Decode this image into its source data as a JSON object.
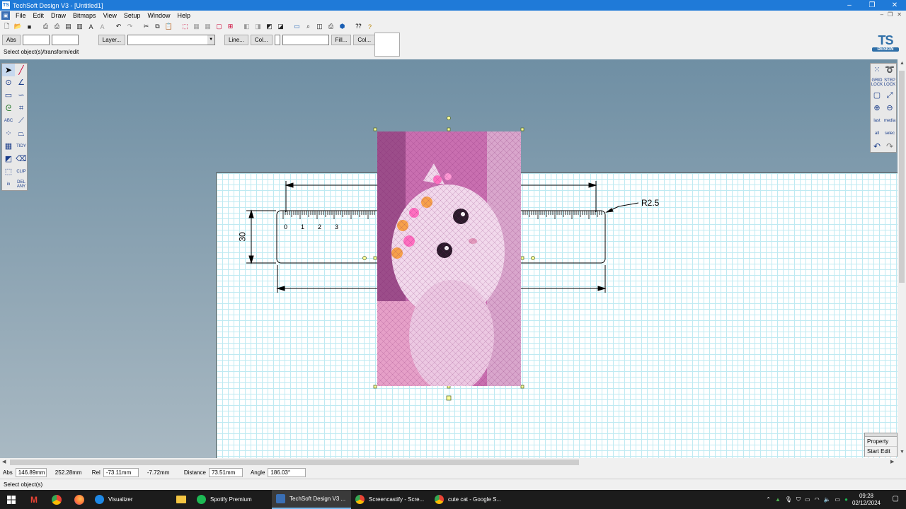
{
  "window": {
    "title": "TechSoft Design V3 - [Untitled1]",
    "app_icon": "TS",
    "controls": [
      "–",
      "❐",
      "✕"
    ]
  },
  "menu": [
    "File",
    "Edit",
    "Draw",
    "Bitmaps",
    "View",
    "Setup",
    "Window",
    "Help"
  ],
  "propbar": {
    "abs_label": "Abs",
    "layer_label": "Layer...",
    "line_label": "Line...",
    "col_label": "Col...",
    "fill_label": "Fill...",
    "col2_label": "Col..."
  },
  "status_hint": "Select object(s)/transform/edit",
  "logo": {
    "ts": "TS",
    "design": "DESIGN"
  },
  "left_tools": [
    "select-arrow",
    "line",
    "circle",
    "arc",
    "rectangle",
    "curve",
    "spiral",
    "grid-distort",
    "ABC",
    "text-warp",
    "dots",
    "perspective",
    "array",
    "TIDY",
    "layers",
    "eraser",
    "node",
    "CLIP",
    "in",
    "DEL ANY"
  ],
  "right_tools": [
    "grid-dots",
    "lasso",
    "GRID LOCK",
    "STEP LOCK",
    "box",
    "measure",
    "zoom-in",
    "zoom-out",
    "last",
    "media",
    "all",
    "selec",
    "undo",
    "redo"
  ],
  "drawing": {
    "radius_label": "R2.5",
    "height_label": "30",
    "ruler_numbers": [
      "0",
      "1",
      "2",
      "3"
    ]
  },
  "property_panel": {
    "property": "Property",
    "start_edit": "Start Edit"
  },
  "coords": {
    "abs_label": "Abs",
    "abs_x": "146.89mm",
    "abs_y": "252.28mm",
    "rel_label": "Rel",
    "rel_x": "-73.11mm",
    "rel_y": "-7.72mm",
    "distance_label": "Distance",
    "distance": "73.51mm",
    "angle_label": "Angle",
    "angle": "186.03°"
  },
  "message": "Select object(s)",
  "taskbar": {
    "apps": [
      {
        "label": "Visualizer",
        "color": "#1e88e5",
        "active": false
      },
      {
        "label": "Spotify Premium",
        "color": "#1db954",
        "active": false
      },
      {
        "label": "TechSoft Design V3 ...",
        "color": "#3a6fb5",
        "active": true
      },
      {
        "label": "Screencastify - Scre...",
        "color": "#e8a735",
        "active": false
      },
      {
        "label": "cute cat - Google S...",
        "color": "#db4437",
        "active": false
      }
    ],
    "time": "09:28",
    "date": "02/12/2024"
  }
}
